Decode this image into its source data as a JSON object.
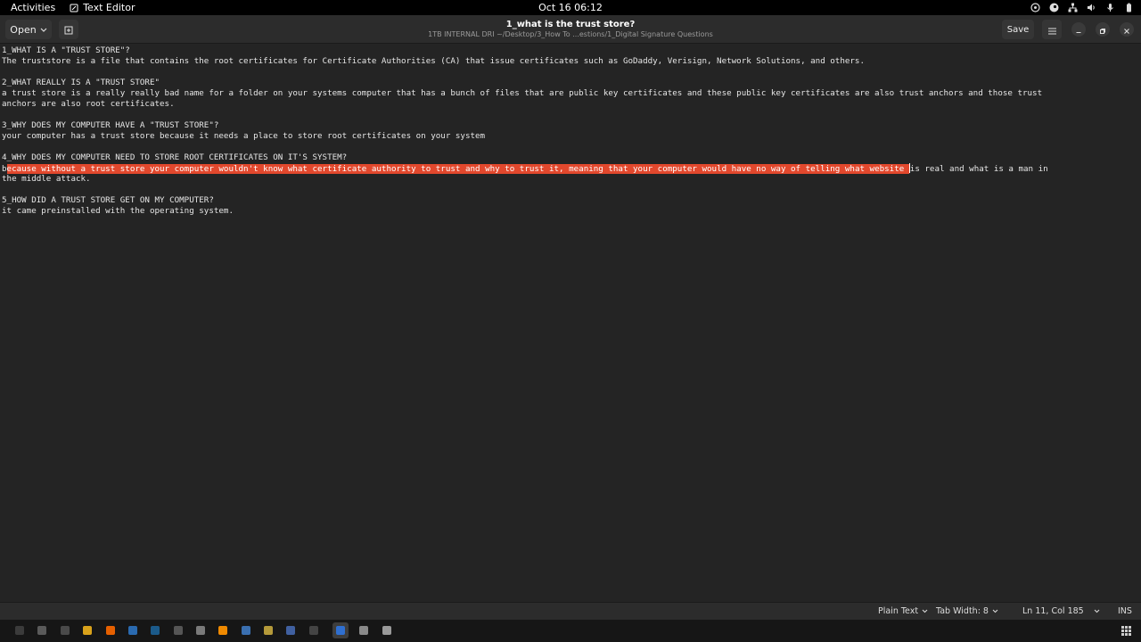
{
  "topbar": {
    "activities": "Activities",
    "app_name": "Text Editor",
    "clock": "Oct 16  06:12"
  },
  "header": {
    "open_label": "Open",
    "title": "1_what is the trust store?",
    "path": "1TB INTERNAL DRI ~/Desktop/3_How To ...estions/1_Digital Signature Questions",
    "save_label": "Save"
  },
  "editor": {
    "lines": [
      "1_WHAT IS A \"TRUST STORE\"?",
      "The truststore is a file that contains the root certificates for Certificate Authorities (CA) that issue certificates such as GoDaddy, Verisign, Network Solutions, and others.",
      "",
      "2_WHAT REALLY IS A \"TRUST STORE\"",
      "a trust store is a really really bad name for a folder on your systems computer that has a bunch of files that are public key certificates and these public key certificates are also trust anchors and those trust",
      "anchors are also root certificates.",
      "",
      "3_WHY DOES MY COMPUTER HAVE A \"TRUST STORE\"?",
      "your computer has a trust store because it needs a place to store root certificates on your system",
      "",
      "4_WHY DOES MY COMPUTER NEED TO STORE ROOT CERTIFICATES ON IT'S SYSTEM?",
      "",
      "the middle attack.",
      "",
      "5_HOW DID A TRUST STORE GET ON MY COMPUTER?",
      "it came preinstalled with the operating system."
    ],
    "sel_line": {
      "before": "b",
      "selected": "ecause without a trust store your computer wouldn't know what certificate authority to trust and why to trust it, meaning that your computer would have no way of telling what website ",
      "after": "is real and what is a man in"
    }
  },
  "status": {
    "language": "Plain Text",
    "tab_width": "Tab Width: 8",
    "position": "Ln 11, Col 185",
    "mode": "INS"
  },
  "dock": {
    "apps": [
      {
        "name": "terminal",
        "color": "#3b3b3b"
      },
      {
        "name": "files-alt",
        "color": "#5a5a5a"
      },
      {
        "name": "files",
        "color": "#4a4a4a"
      },
      {
        "name": "chrome",
        "color": "#d9a21b"
      },
      {
        "name": "firefox",
        "color": "#e66000"
      },
      {
        "name": "app-blue",
        "color": "#2a6ab0"
      },
      {
        "name": "steam",
        "color": "#1b5a8a"
      },
      {
        "name": "app-dark",
        "color": "#555555"
      },
      {
        "name": "app-spiral",
        "color": "#7a7a7a"
      },
      {
        "name": "vlc",
        "color": "#f08a00"
      },
      {
        "name": "app-bluebird",
        "color": "#3a6fb0"
      },
      {
        "name": "app-gear",
        "color": "#b59a3a"
      },
      {
        "name": "app-circle",
        "color": "#4060a0"
      },
      {
        "name": "app-terminal2",
        "color": "#444444"
      },
      {
        "name": "text-editor",
        "color": "#2f6fd0"
      },
      {
        "name": "document",
        "color": "#8a8a8a"
      },
      {
        "name": "document2",
        "color": "#9a9a9a"
      }
    ]
  },
  "colors": {
    "selection": "#e2482d",
    "background": "#242424"
  }
}
